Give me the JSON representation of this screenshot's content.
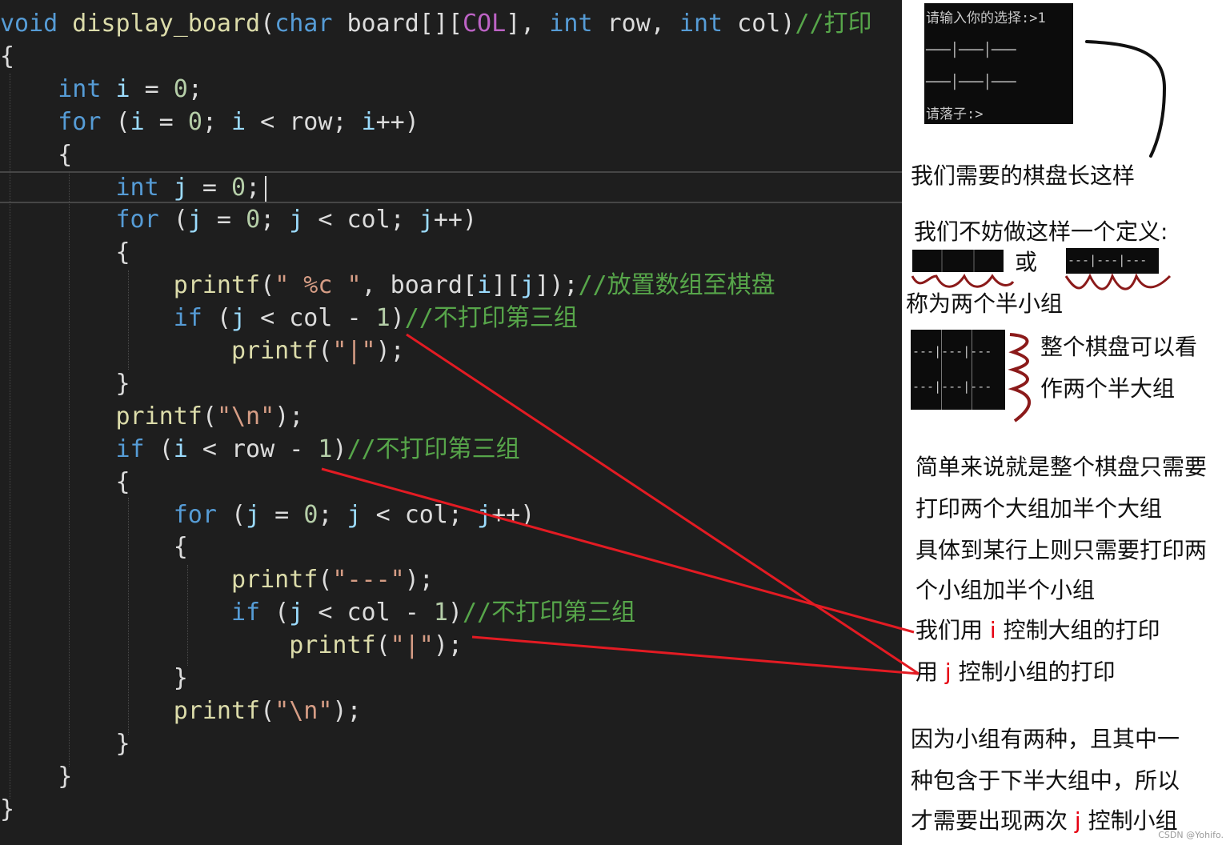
{
  "code": {
    "lines": [
      [
        {
          "t": "void",
          "c": "kw"
        },
        {
          "t": " display_board",
          "c": "fn"
        },
        {
          "t": "(",
          "c": "id"
        },
        {
          "t": "char",
          "c": "kw"
        },
        {
          "t": " board[][",
          "c": "id"
        },
        {
          "t": "COL",
          "c": "macro"
        },
        {
          "t": "], ",
          "c": "id"
        },
        {
          "t": "int",
          "c": "kw"
        },
        {
          "t": " row, ",
          "c": "id"
        },
        {
          "t": "int",
          "c": "kw"
        },
        {
          "t": " col)",
          "c": "id"
        },
        {
          "t": "//打印",
          "c": "cm"
        }
      ],
      [
        {
          "t": "{",
          "c": "id"
        }
      ],
      [
        {
          "t": "    ",
          "c": "id"
        },
        {
          "t": "int",
          "c": "kw"
        },
        {
          "t": " ",
          "c": "id"
        },
        {
          "t": "i",
          "c": "var"
        },
        {
          "t": " = ",
          "c": "id"
        },
        {
          "t": "0",
          "c": "num"
        },
        {
          "t": ";",
          "c": "id"
        }
      ],
      [
        {
          "t": "    ",
          "c": "id"
        },
        {
          "t": "for",
          "c": "kw"
        },
        {
          "t": " (",
          "c": "id"
        },
        {
          "t": "i",
          "c": "var"
        },
        {
          "t": " = ",
          "c": "id"
        },
        {
          "t": "0",
          "c": "num"
        },
        {
          "t": "; ",
          "c": "id"
        },
        {
          "t": "i",
          "c": "var"
        },
        {
          "t": " < row; ",
          "c": "id"
        },
        {
          "t": "i",
          "c": "var"
        },
        {
          "t": "++)",
          "c": "id"
        }
      ],
      [
        {
          "t": "    {",
          "c": "id"
        }
      ],
      [
        {
          "t": "        ",
          "c": "id"
        },
        {
          "t": "int",
          "c": "kw"
        },
        {
          "t": " ",
          "c": "id"
        },
        {
          "t": "j",
          "c": "var"
        },
        {
          "t": " = ",
          "c": "id"
        },
        {
          "t": "0",
          "c": "num"
        },
        {
          "t": ";",
          "c": "id"
        }
      ],
      [
        {
          "t": "        ",
          "c": "id"
        },
        {
          "t": "for",
          "c": "kw"
        },
        {
          "t": " (",
          "c": "id"
        },
        {
          "t": "j",
          "c": "var"
        },
        {
          "t": " = ",
          "c": "id"
        },
        {
          "t": "0",
          "c": "num"
        },
        {
          "t": "; ",
          "c": "id"
        },
        {
          "t": "j",
          "c": "var"
        },
        {
          "t": " < col; ",
          "c": "id"
        },
        {
          "t": "j",
          "c": "var"
        },
        {
          "t": "++)",
          "c": "id"
        }
      ],
      [
        {
          "t": "        {",
          "c": "id"
        }
      ],
      [
        {
          "t": "            ",
          "c": "id"
        },
        {
          "t": "printf",
          "c": "fn"
        },
        {
          "t": "(",
          "c": "id"
        },
        {
          "t": "\" %c \"",
          "c": "str"
        },
        {
          "t": ", board[",
          "c": "id"
        },
        {
          "t": "i",
          "c": "var"
        },
        {
          "t": "][",
          "c": "id"
        },
        {
          "t": "j",
          "c": "var"
        },
        {
          "t": "]);",
          "c": "id"
        },
        {
          "t": "//放置数组至棋盘",
          "c": "cm"
        }
      ],
      [
        {
          "t": "            ",
          "c": "id"
        },
        {
          "t": "if",
          "c": "kw"
        },
        {
          "t": " (",
          "c": "id"
        },
        {
          "t": "j",
          "c": "var"
        },
        {
          "t": " < col - ",
          "c": "id"
        },
        {
          "t": "1",
          "c": "num"
        },
        {
          "t": ")",
          "c": "id"
        },
        {
          "t": "//不打印第三组",
          "c": "cm"
        }
      ],
      [
        {
          "t": "                ",
          "c": "id"
        },
        {
          "t": "printf",
          "c": "fn"
        },
        {
          "t": "(",
          "c": "id"
        },
        {
          "t": "\"|\"",
          "c": "str"
        },
        {
          "t": ");",
          "c": "id"
        }
      ],
      [
        {
          "t": "        }",
          "c": "id"
        }
      ],
      [
        {
          "t": "        ",
          "c": "id"
        },
        {
          "t": "printf",
          "c": "fn"
        },
        {
          "t": "(",
          "c": "id"
        },
        {
          "t": "\"\\n\"",
          "c": "str"
        },
        {
          "t": ");",
          "c": "id"
        }
      ],
      [
        {
          "t": "        ",
          "c": "id"
        },
        {
          "t": "if",
          "c": "kw"
        },
        {
          "t": " (",
          "c": "id"
        },
        {
          "t": "i",
          "c": "var"
        },
        {
          "t": " < row - ",
          "c": "id"
        },
        {
          "t": "1",
          "c": "num"
        },
        {
          "t": ")",
          "c": "id"
        },
        {
          "t": "//不打印第三组",
          "c": "cm"
        }
      ],
      [
        {
          "t": "        {",
          "c": "id"
        }
      ],
      [
        {
          "t": "            ",
          "c": "id"
        },
        {
          "t": "for",
          "c": "kw"
        },
        {
          "t": " (",
          "c": "id"
        },
        {
          "t": "j",
          "c": "var"
        },
        {
          "t": " = ",
          "c": "id"
        },
        {
          "t": "0",
          "c": "num"
        },
        {
          "t": "; ",
          "c": "id"
        },
        {
          "t": "j",
          "c": "var"
        },
        {
          "t": " < col; ",
          "c": "id"
        },
        {
          "t": "j",
          "c": "var"
        },
        {
          "t": "++)",
          "c": "id"
        }
      ],
      [
        {
          "t": "            {",
          "c": "id"
        }
      ],
      [
        {
          "t": "                ",
          "c": "id"
        },
        {
          "t": "printf",
          "c": "fn"
        },
        {
          "t": "(",
          "c": "id"
        },
        {
          "t": "\"---\"",
          "c": "str"
        },
        {
          "t": ");",
          "c": "id"
        }
      ],
      [
        {
          "t": "                ",
          "c": "id"
        },
        {
          "t": "if",
          "c": "kw"
        },
        {
          "t": " (",
          "c": "id"
        },
        {
          "t": "j",
          "c": "var"
        },
        {
          "t": " < col - ",
          "c": "id"
        },
        {
          "t": "1",
          "c": "num"
        },
        {
          "t": ")",
          "c": "id"
        },
        {
          "t": "//不打印第三组",
          "c": "cm"
        }
      ],
      [
        {
          "t": "                    ",
          "c": "id"
        },
        {
          "t": "printf",
          "c": "fn"
        },
        {
          "t": "(",
          "c": "id"
        },
        {
          "t": "\"|\"",
          "c": "str"
        },
        {
          "t": ");",
          "c": "id"
        }
      ],
      [
        {
          "t": "            }",
          "c": "id"
        }
      ],
      [
        {
          "t": "            ",
          "c": "id"
        },
        {
          "t": "printf",
          "c": "fn"
        },
        {
          "t": "(",
          "c": "id"
        },
        {
          "t": "\"\\n\"",
          "c": "str"
        },
        {
          "t": ");",
          "c": "id"
        }
      ],
      [
        {
          "t": "        }",
          "c": "id"
        }
      ],
      [
        {
          "t": "    }",
          "c": "id"
        }
      ],
      [
        {
          "t": "}",
          "c": "id"
        }
      ]
    ]
  },
  "console": {
    "prompt_choice": "请输入你的选择:>1",
    "row1": "───│───│───",
    "row2": "───│───│───",
    "prompt_move": "请落子:>"
  },
  "mini_board_row": "---|---|---",
  "notes": {
    "board_like_this": "我们需要的棋盘长这样",
    "define": "我们不妨做这样一个定义:",
    "or": "或",
    "half_small": "称为两个半小组",
    "whole_board_1": "整个棋盘可以看",
    "whole_board_2": "作两个半大组",
    "simple_1": "简单来说就是整个棋盘只需要",
    "simple_2": "打印两个大组加半个大组",
    "simple_3": "具体到某行上则只需要打印两",
    "simple_4": "个小组加半个小组",
    "use_i_pre": "我们用 ",
    "use_i_var": "i",
    "use_i_post": " 控制大组的打印",
    "use_j_pre": "用 ",
    "use_j_var": "j",
    "use_j_post": " 控制小组的打印",
    "because_1": "因为小组有两种，且其中一",
    "because_2": "种包含于下半大组中，所以",
    "because_3_pre": "才需要出现两次 ",
    "because_3_var": "j",
    "because_3_post": " 控制小组"
  },
  "watermark": "CSDN @Yohifo.",
  "colors": {
    "editor_bg": "#1e1e1e",
    "keyword": "#569cd6",
    "comment": "#57a64a",
    "string": "#d69d85",
    "function": "#dcdcaa",
    "variable": "#9cdcfe",
    "arrow_red": "#e31b23",
    "brace_dark_red": "#8b1a1a"
  }
}
